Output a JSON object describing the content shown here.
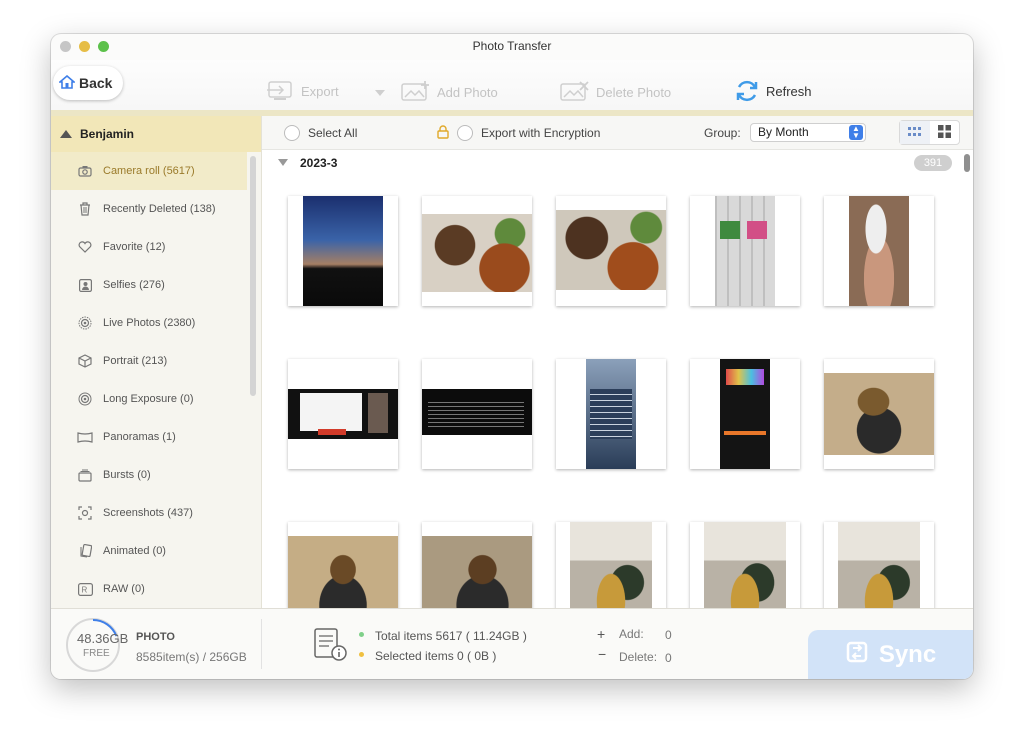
{
  "window": {
    "title": "Photo Transfer"
  },
  "toolbar": {
    "back_label": "Back",
    "export_label": "Export",
    "add_photo_label": "Add Photo",
    "delete_photo_label": "Delete Photo",
    "refresh_label": "Refresh"
  },
  "sidebar": {
    "device_name": "Benjamin",
    "items": [
      {
        "label": "Camera roll (5617)",
        "icon": "camera-icon"
      },
      {
        "label": "Recently Deleted (138)",
        "icon": "trash-icon"
      },
      {
        "label": "Favorite (12)",
        "icon": "heart-icon"
      },
      {
        "label": "Selfies (276)",
        "icon": "person-square-icon"
      },
      {
        "label": "Live Photos (2380)",
        "icon": "live-photo-icon"
      },
      {
        "label": "Portrait (213)",
        "icon": "cube-icon"
      },
      {
        "label": "Long Exposure (0)",
        "icon": "long-exposure-icon"
      },
      {
        "label": "Panoramas (1)",
        "icon": "panorama-icon"
      },
      {
        "label": "Bursts (0)",
        "icon": "burst-icon"
      },
      {
        "label": "Screenshots (437)",
        "icon": "screenshot-icon"
      },
      {
        "label": "Animated (0)",
        "icon": "animated-icon"
      },
      {
        "label": "RAW (0)",
        "icon": "raw-icon"
      }
    ]
  },
  "filters": {
    "select_all": "Select All",
    "export_encryption": "Export with Encryption",
    "group_label": "Group:",
    "group_value": "By Month"
  },
  "gallery": {
    "month": "2023-3",
    "count": "391"
  },
  "status": {
    "free_space": "48.36GB",
    "free_label": "FREE",
    "category": "PHOTO",
    "usage": "8585item(s) / 256GB",
    "total_items": "Total items 5617 ( 11.24GB )",
    "selected_items": "Selected items 0 ( 0B )",
    "add_label": "Add:",
    "add_value": "0",
    "delete_label": "Delete:",
    "delete_value": "0",
    "sync_label": "Sync"
  },
  "colors": {
    "accent": "#3f7fe8",
    "sidebar_highlight": "#f2ebc9",
    "sync_button": "#d2e3f8"
  }
}
